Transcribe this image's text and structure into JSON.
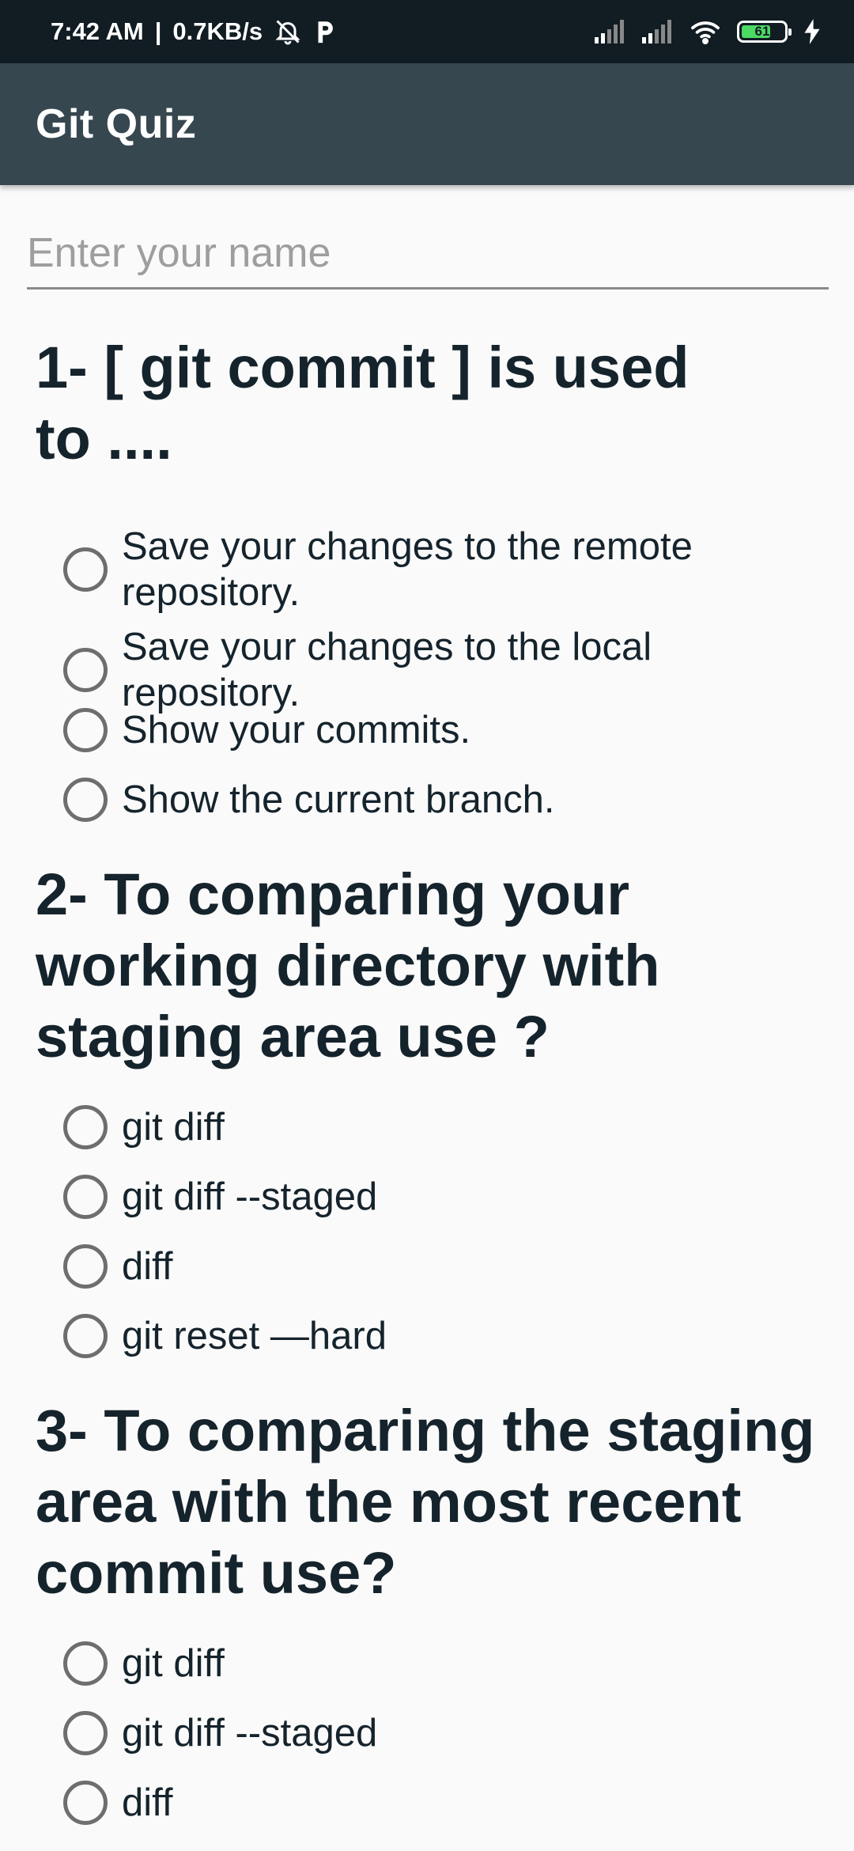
{
  "status_bar": {
    "time": "7:42 AM",
    "separator": "|",
    "network_speed": "0.7KB/s",
    "battery_level": "61",
    "icons": [
      "alarm-off-icon",
      "parking-icon",
      "signal-icon",
      "signal-icon",
      "wifi-icon",
      "battery-icon",
      "charging-icon"
    ]
  },
  "app_bar": {
    "title": "Git Quiz"
  },
  "form": {
    "name_placeholder": "Enter your name",
    "name_value": ""
  },
  "questions": [
    {
      "title": "1- [ git commit ] is used to ....",
      "options": [
        "Save your changes to the remote repository.",
        "Save your changes to the local repository.",
        "Show your commits.",
        "Show the current branch."
      ]
    },
    {
      "title": "2- To comparing your working directory with staging area use ?",
      "options": [
        "git diff",
        "git diff --staged",
        "diff",
        "git reset —hard"
      ]
    },
    {
      "title": "3- To comparing the staging area with the most recent commit use?",
      "options": [
        "git diff",
        "git diff --staged",
        "diff"
      ]
    }
  ],
  "colors": {
    "status_bar_bg": "#111c23",
    "app_bar_bg": "#37474f",
    "page_bg": "#fafafa",
    "text": "#15232c",
    "radio": "#6e6e6e"
  }
}
